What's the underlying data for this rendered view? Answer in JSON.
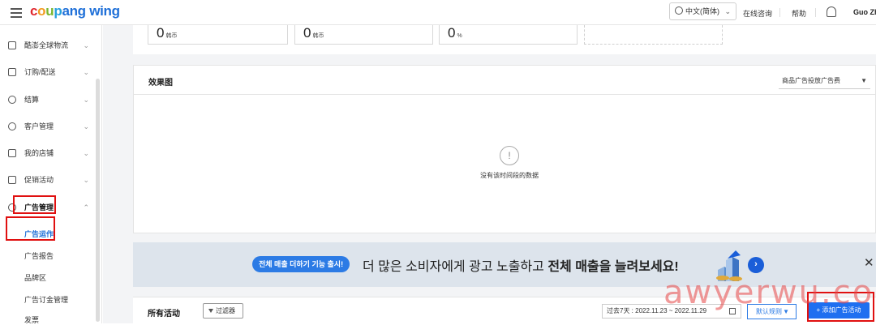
{
  "topbar": {
    "logo": {
      "c1": "c",
      "c2": "o",
      "c3": "u",
      "c4": "p",
      "c5": "ang",
      "wing": "wing"
    },
    "language": "中文(简体)",
    "consult": "在线咨询",
    "help": "帮助",
    "user": "Guo Zh"
  },
  "sidebar": {
    "items": [
      {
        "label": "酷澎全球物流"
      },
      {
        "label": "订购/配送"
      },
      {
        "label": "结算"
      },
      {
        "label": "客户管理"
      },
      {
        "label": "我的店铺"
      },
      {
        "label": "促销活动"
      },
      {
        "label": "广告管理"
      }
    ],
    "subitems": [
      {
        "label": "广告运作"
      },
      {
        "label": "广告报告"
      },
      {
        "label": "品牌区"
      },
      {
        "label": "广告订金管理"
      },
      {
        "label": "发票"
      }
    ]
  },
  "stats": [
    {
      "value": "0",
      "unit": "韩币"
    },
    {
      "value": "0",
      "unit": "韩币"
    },
    {
      "value": "0",
      "unit": "%"
    }
  ],
  "chart_panel": {
    "title": "效果图",
    "metric_select": "商品广告投放广告费",
    "empty_text": "没有该时间段的数据"
  },
  "banner": {
    "pill": "전체 매출 더하기 기능 출시!",
    "text_normal": "더 많은 소비자에게 광고 노출하고 ",
    "text_bold": "전체 매출을 늘려보세요!"
  },
  "activities": {
    "title": "所有活动",
    "filter": "过滤器",
    "date_range": "过去7天 : 2022.11.23 ~ 2022.11.29",
    "sort": "默认规则",
    "add": "+ 添加广告活动"
  },
  "watermark": "awyerwu.com"
}
